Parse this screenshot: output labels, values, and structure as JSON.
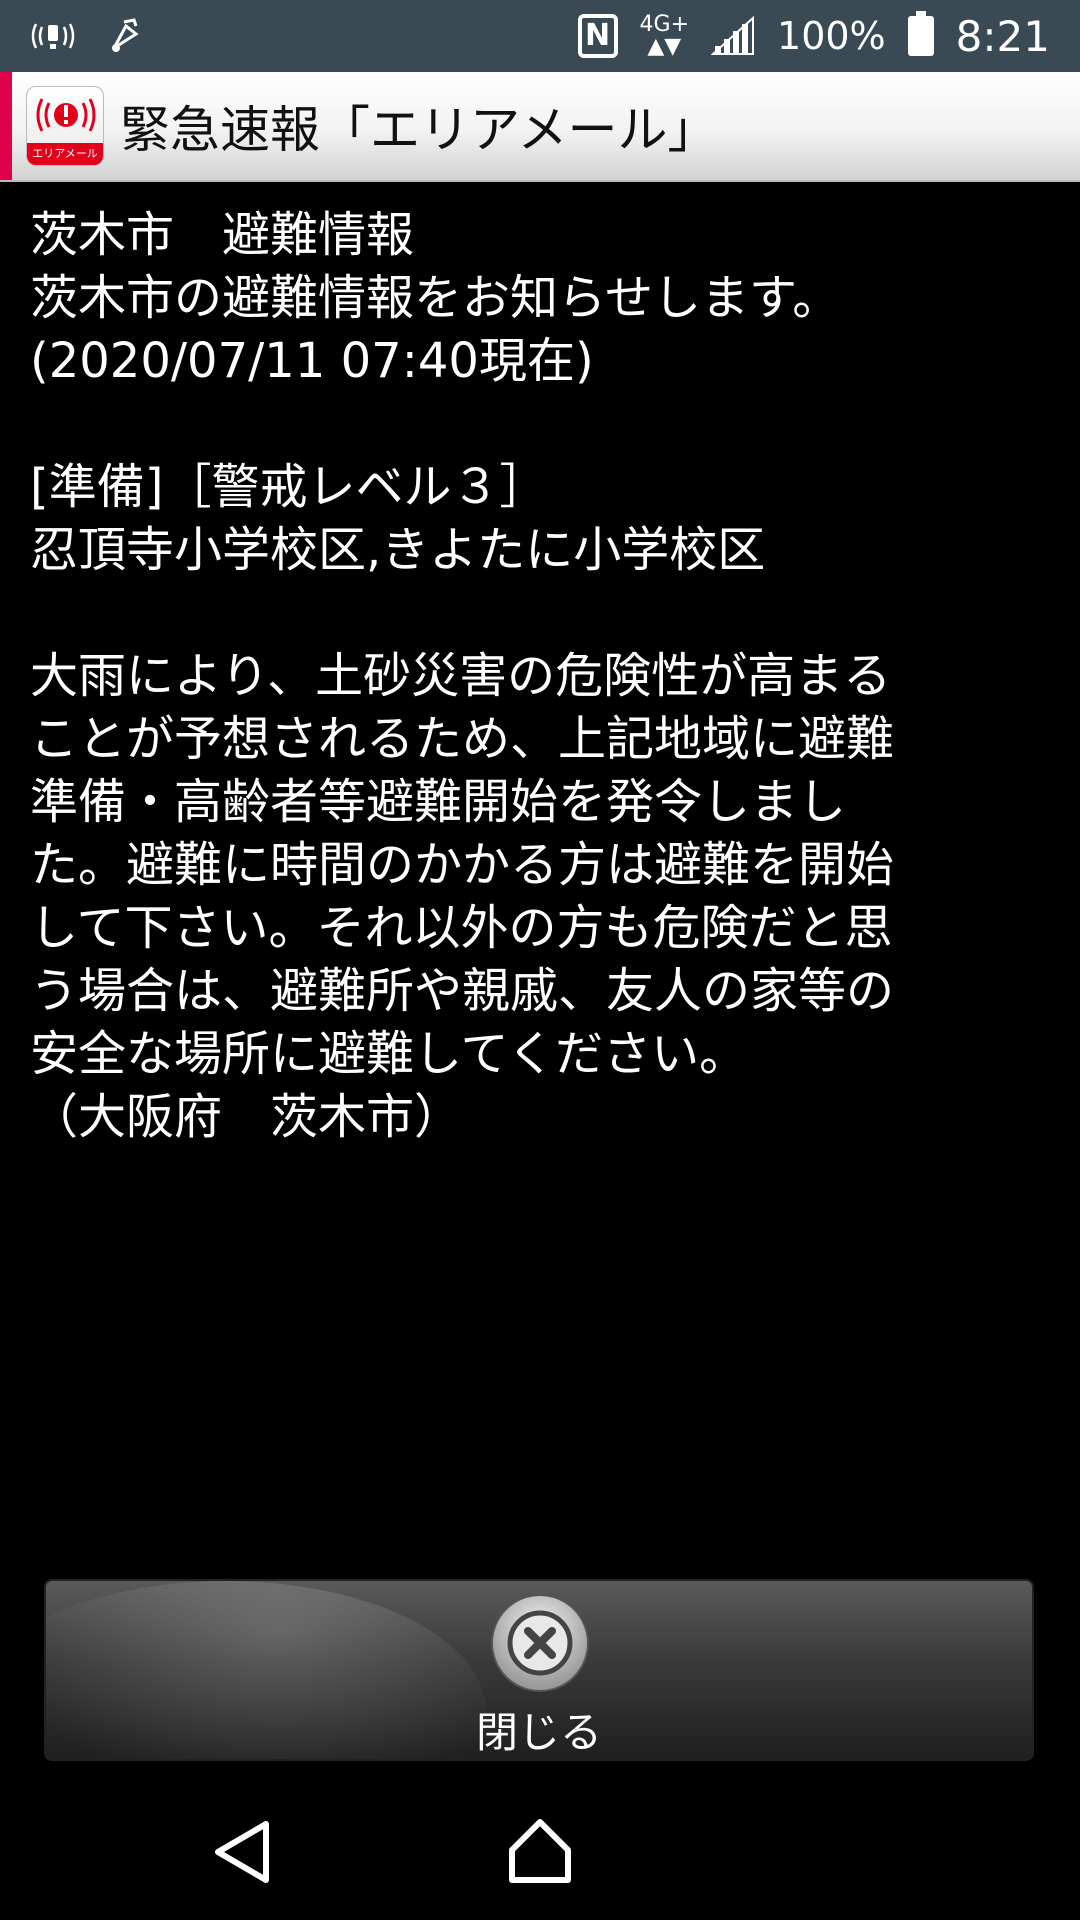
{
  "status_bar": {
    "network_type": "4G+",
    "battery_percent": "100%",
    "time": "8:21",
    "icons": [
      "vibrate-icon",
      "media-icon",
      "nfc-icon",
      "data-arrows-icon",
      "signal-icon",
      "battery-icon"
    ]
  },
  "title_bar": {
    "title": "緊急速報「エリアメール」",
    "logo_text": "エリアメール",
    "accent_color": "#e0004d"
  },
  "message": {
    "heading": "茨木市　避難情報",
    "intro": "茨木市の避難情報をお知らせします。",
    "timestamp": "(2020/07/11 07:40現在)",
    "level": "[準備]［警戒レベル３］",
    "areas": "忍頂寺小学校区,きよたに小学校区",
    "body_lines": [
      "大雨により、土砂災害の危険性が高まる",
      "ことが予想されるため、上記地域に避難",
      "準備・高齢者等避難開始を発令しまし",
      "た。避難に時間のかかる方は避難を開始",
      "して下さい。それ以外の方も危険だと思",
      "う場合は、避難所や親戚、友人の家等の",
      "安全な場所に避難してください。"
    ],
    "sender": "（大阪府　茨木市）"
  },
  "close_button": {
    "label": "閉じる",
    "icon": "close-icon"
  },
  "nav_bar": {
    "icons": [
      "back-icon",
      "home-icon"
    ]
  }
}
